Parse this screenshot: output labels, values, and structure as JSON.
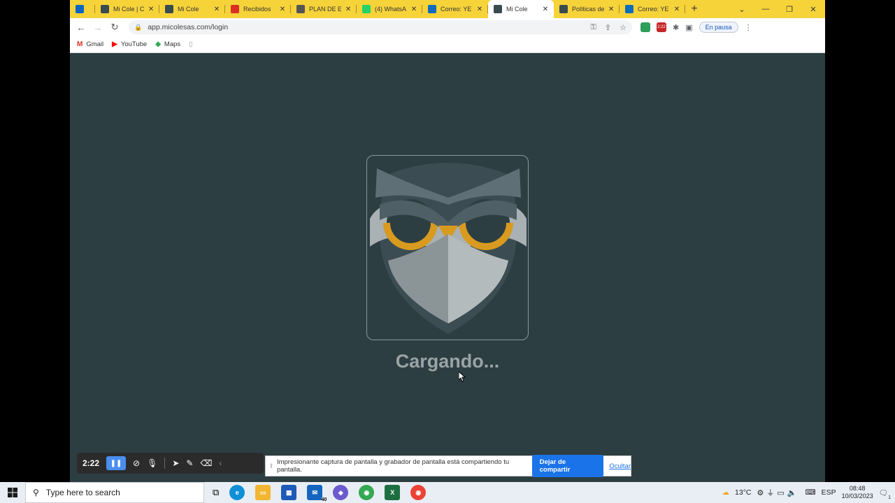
{
  "browser": {
    "tabs": [
      {
        "label": "",
        "icon": "linkedin-icon",
        "color": "#0a66c2",
        "width": 36
      },
      {
        "label": "Mi Cole | C",
        "icon": "owl-icon",
        "color": "#3a4b50",
        "width": 92
      },
      {
        "label": "Mi Cole",
        "icon": "owl-icon",
        "color": "#3a4b50",
        "width": 94
      },
      {
        "label": "Recibidos",
        "icon": "gmail-icon",
        "color": "#d93025",
        "width": 94
      },
      {
        "label": "PLAN DE E",
        "icon": "globe-icon",
        "color": "#555555",
        "width": 94
      },
      {
        "label": "(4) WhatsA",
        "icon": "whatsapp-icon",
        "color": "#25d366",
        "width": 94
      },
      {
        "label": "Correo: YE",
        "icon": "outlook-icon",
        "color": "#0f6cbd",
        "width": 94
      },
      {
        "label": "Mi Cole",
        "icon": "owl-icon",
        "color": "#3a4b50",
        "width": 94,
        "active": true
      },
      {
        "label": "Políticas de",
        "icon": "owl-icon",
        "color": "#3a4b50",
        "width": 94
      },
      {
        "label": "Correo: YE",
        "icon": "outlook-icon",
        "color": "#0f6cbd",
        "width": 94
      }
    ],
    "url": "app.micolesas.com/login",
    "pause_label": "En pausa",
    "ext_badge": "2:22",
    "bookmarks": [
      {
        "label": "Gmail",
        "icon": "gmail-icon",
        "color": "#d93025",
        "glyph": "M"
      },
      {
        "label": "YouTube",
        "icon": "youtube-icon",
        "color": "#ff0000",
        "glyph": "▶"
      },
      {
        "label": "Maps",
        "icon": "maps-icon",
        "color": "#34a853",
        "glyph": "◆"
      }
    ]
  },
  "page": {
    "loading_text": "Cargando..."
  },
  "recorder": {
    "timer": "2:22",
    "share_message": "Impresionante captura de pantalla y grabador de pantalla está compartiendo tu pantalla.",
    "stop_label": "Dejar de compartir",
    "hide_label": "Ocultar"
  },
  "taskbar": {
    "search_placeholder": "Type here to search",
    "mail_badge": "40",
    "temperature": "13°C",
    "language": "ESP",
    "time": "08:48",
    "date": "10/03/2023",
    "notification_count": "1"
  }
}
